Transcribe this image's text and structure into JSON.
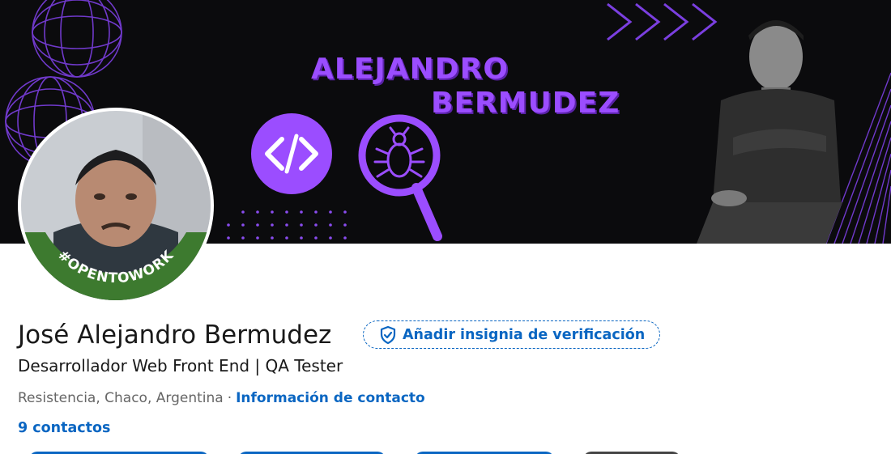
{
  "banner": {
    "title_line1": "ALEJANDRO",
    "title_line2": "BERMUDEZ",
    "code_icon": "code-icon",
    "bug_search_icon": "bug-search-icon",
    "accent_color": "#9b4dff"
  },
  "avatar": {
    "badge_text": "#OPENTOWORK",
    "badge_color": "#3d7a2f"
  },
  "profile": {
    "name": "José Alejandro Bermudez",
    "verify_label": "Añadir insignia de verificación",
    "verify_icon": "shield-check-icon",
    "headline": "Desarrollador Web Front End | QA Tester",
    "location": "Resistencia, Chaco, Argentina",
    "separator": "·",
    "contact_link": "Información de contacto",
    "connections": "9 contactos"
  },
  "colors": {
    "link": "#0a66c2",
    "text": "#191919",
    "muted": "#666666"
  }
}
